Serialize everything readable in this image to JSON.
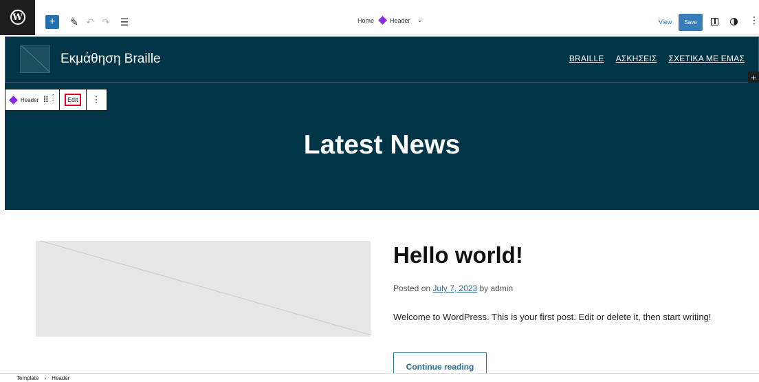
{
  "editor": {
    "document": {
      "home_label": "Home",
      "part_label": "Header"
    },
    "view_label": "View",
    "save_label": "Save"
  },
  "site": {
    "title": "Εκμάθηση Braille",
    "nav": [
      "BRAILLE",
      "ΑΣΚΗΣΕΙΣ",
      "ΣΧΕΤΙΚΑ ΜΕ ΕΜΑΣ"
    ]
  },
  "block_toolbar": {
    "label": "Header",
    "edit_label": "Edit"
  },
  "hero": {
    "title": "Latest News"
  },
  "post": {
    "title": "Hello world!",
    "posted_on": "Posted on",
    "date": "July 7, 2023",
    "by": "by",
    "author": "admin",
    "excerpt": "Welcome to WordPress. This is your first post. Edit or delete it, then start writing!",
    "continue_label": "Continue reading"
  },
  "breadcrumb": [
    "Template",
    "Header"
  ],
  "colors": {
    "header_bg": "#003447",
    "accent": "#2271b1",
    "template_part": "#8a2be2",
    "edit_highlight": "#e3002a"
  }
}
